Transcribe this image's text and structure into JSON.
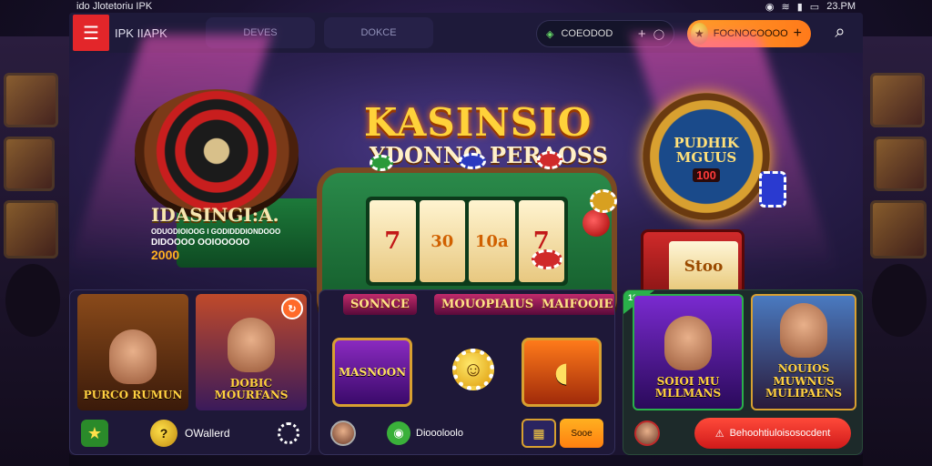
{
  "status_bar": {
    "left_text": "ido Jlotetoriu IPK",
    "time": "23.PM"
  },
  "header": {
    "brand": "IPK IIAPK",
    "tabs": [
      {
        "label": "DEVES"
      },
      {
        "label": "DOKCE"
      }
    ],
    "balance_pill": {
      "label": "COEODOD",
      "plus": "+"
    },
    "promo_pill": {
      "label": "FOCNOCOOOO",
      "arrow": "+"
    }
  },
  "hero": {
    "title": "KASINSIO",
    "subtitle": "YDONNO PERAOSS",
    "promo": {
      "title": "IDASINGI:A.",
      "line1": "ODUODIOIOOG I GODIDDDIONDOOO",
      "line2": "DIDOOOO OOIOOOOO",
      "value": "2000"
    },
    "reels": [
      "7",
      "30",
      "10a",
      "7"
    ],
    "wheel": {
      "text": "PUDHIK MGUUS",
      "number": "100"
    },
    "mini_machine": {
      "label": "Stoo"
    }
  },
  "cards": {
    "panel1": {
      "thumbs": [
        {
          "label": "PURCO RUMUN"
        },
        {
          "label": "DOBIC MOURFANS"
        }
      ],
      "footer_text": "OWallerd"
    },
    "panel2": {
      "tags": [
        "SONNCE",
        "MOUOPIAIUS",
        "MAIFOOIE"
      ],
      "games": [
        {
          "label": "MASNOON"
        },
        {
          "label": ""
        }
      ],
      "footer_text": "Dioooloolo",
      "button_label": "Sooe"
    },
    "panel3": {
      "badge": "10",
      "thumbs": [
        {
          "label": "SOIOI MU MLLMANS"
        },
        {
          "label": "NOUIOS MUWNUS MULIPAENS"
        }
      ],
      "cta_label": "Behoohtiuloisosocdent"
    }
  },
  "colors": {
    "accent": "#e3262a",
    "gold": "#ffd23a",
    "orange": "#ff8a1a",
    "green": "#1d7a3a"
  }
}
